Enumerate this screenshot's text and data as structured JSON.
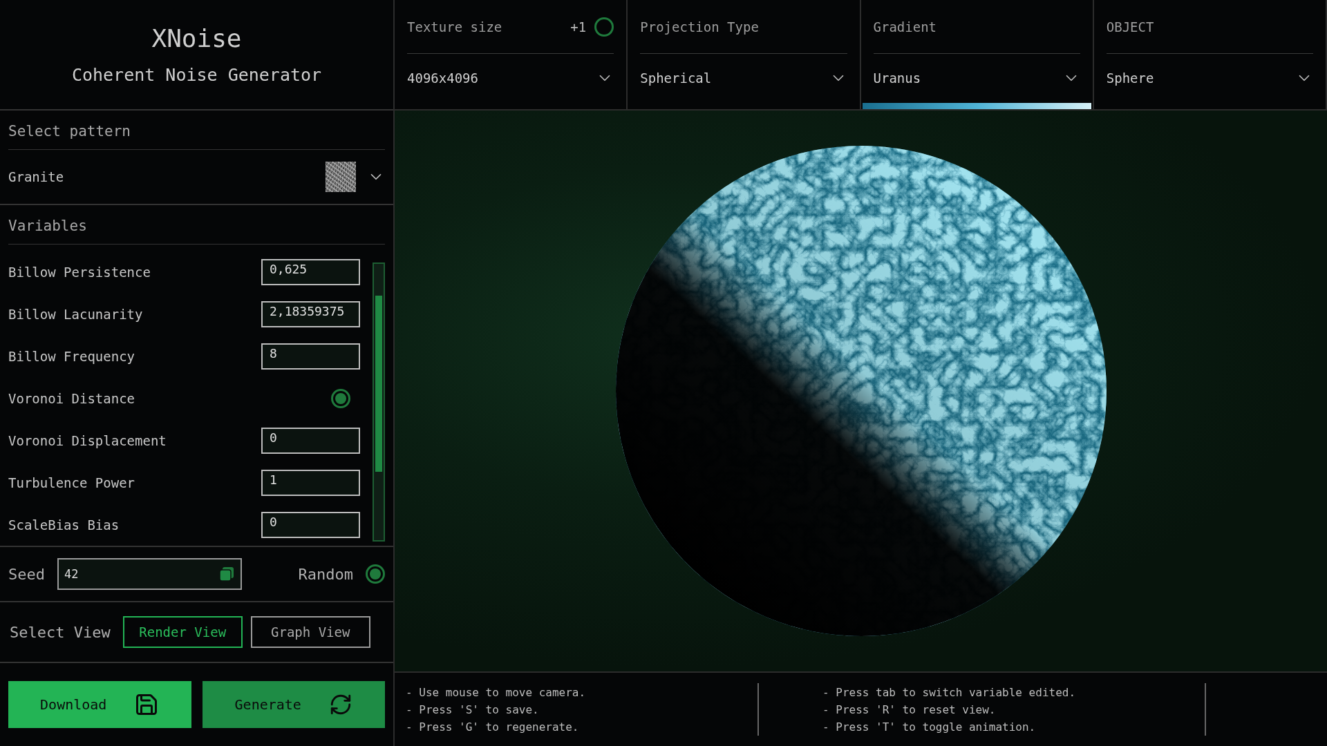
{
  "app": {
    "title": "XNoise",
    "subtitle": "Coherent Noise Generator"
  },
  "top_settings": [
    {
      "kind": "select",
      "label": "Texture size",
      "value": "4096x4096",
      "extra": "+1",
      "toggle_on": false
    },
    {
      "kind": "select",
      "label": "Projection Type",
      "value": "Spherical"
    },
    {
      "kind": "gradient",
      "label": "Gradient",
      "value": "Uranus"
    },
    {
      "kind": "select",
      "label": "OBJECT",
      "value": "Sphere"
    }
  ],
  "pattern": {
    "label": "Select pattern",
    "value": "Granite"
  },
  "variables": {
    "title": "Variables",
    "items": [
      {
        "kind": "number",
        "name": "Billow Persistence",
        "value": "0,625"
      },
      {
        "kind": "number",
        "name": "Billow Lacunarity",
        "value": "2,18359375"
      },
      {
        "kind": "number",
        "name": "Billow Frequency",
        "value": "8"
      },
      {
        "kind": "toggle",
        "name": "Voronoi Distance",
        "on": true
      },
      {
        "kind": "number",
        "name": "Voronoi Displacement",
        "value": "0"
      },
      {
        "kind": "number",
        "name": "Turbulence Power",
        "value": "1"
      },
      {
        "kind": "number",
        "name": "ScaleBias Bias",
        "value": "0"
      }
    ]
  },
  "seed": {
    "label": "Seed",
    "value": "42",
    "random_label": "Random",
    "random_on": true
  },
  "view": {
    "label": "Select View",
    "options": [
      {
        "label": "Render View",
        "selected": true
      },
      {
        "label": "Graph View",
        "selected": false
      }
    ]
  },
  "actions": [
    {
      "kind": "download",
      "label": "Download"
    },
    {
      "kind": "generate",
      "label": "Generate"
    }
  ],
  "hints": [
    [
      "- Use mouse to move camera.",
      "- Press 'S' to save.",
      "- Press 'G' to regenerate."
    ],
    [
      "- Press tab to switch variable edited.",
      "- Press 'R' to reset view.",
      "- Press 'T' to toggle animation."
    ]
  ]
}
